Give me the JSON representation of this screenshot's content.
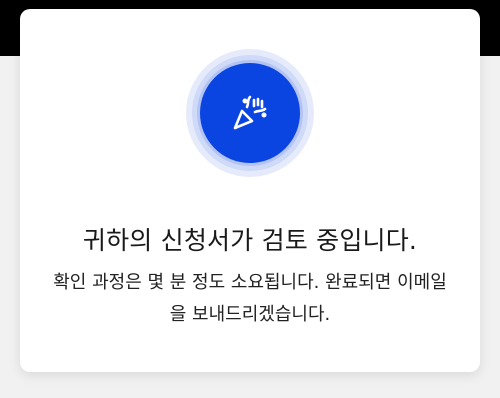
{
  "colors": {
    "accent": "#0a45e1",
    "ring_light": "#e6ebfb",
    "top_band": "#000000",
    "background": "#f1f1f1",
    "card": "#ffffff"
  },
  "dialog": {
    "icon": "party-popper-icon",
    "title": "귀하의 신청서가 검토 중입니다.",
    "description": "확인 과정은 몇 분 정도 소요됩니다. 완료되면 이메일을 보내드리겠습니다."
  }
}
